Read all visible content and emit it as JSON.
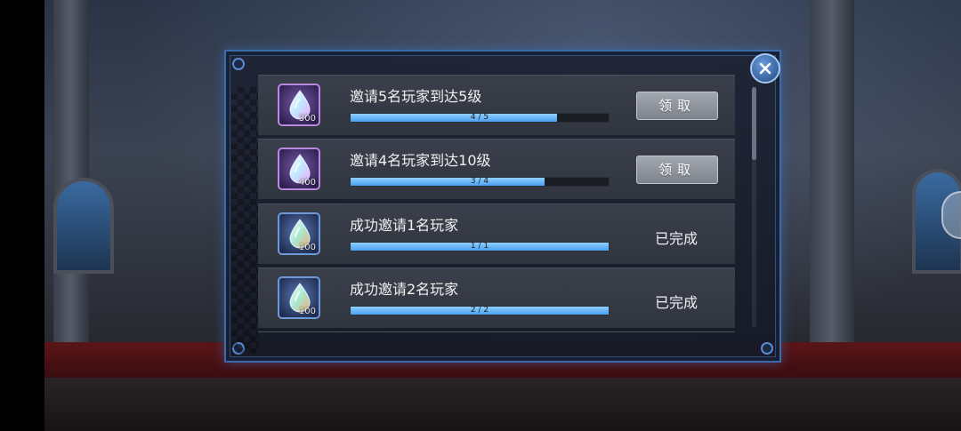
{
  "close_label": "",
  "tasks": [
    {
      "title": "邀请5名玩家到达5级",
      "progress_text": "4 / 5",
      "progress": 0.8,
      "reward_qty": "300",
      "status": "claim",
      "button_label": "领取",
      "icon": "crystal-drop-icon"
    },
    {
      "title": "邀请4名玩家到达10级",
      "progress_text": "3 / 4",
      "progress": 0.75,
      "reward_qty": "400",
      "status": "claim",
      "button_label": "领取",
      "icon": "crystal-drop-icon"
    },
    {
      "title": "成功邀请1名玩家",
      "progress_text": "1 / 1",
      "progress": 1.0,
      "reward_qty": "100",
      "status": "done",
      "done_label": "已完成",
      "icon": "crystal-drop-icon"
    },
    {
      "title": "成功邀请2名玩家",
      "progress_text": "2 / 2",
      "progress": 1.0,
      "reward_qty": "100",
      "status": "done",
      "done_label": "已完成",
      "icon": "crystal-drop-icon"
    }
  ],
  "colors": {
    "accent": "#3d6aa8",
    "progress_fill": "#6ab8f8",
    "panel_bg": "#1e2434"
  }
}
